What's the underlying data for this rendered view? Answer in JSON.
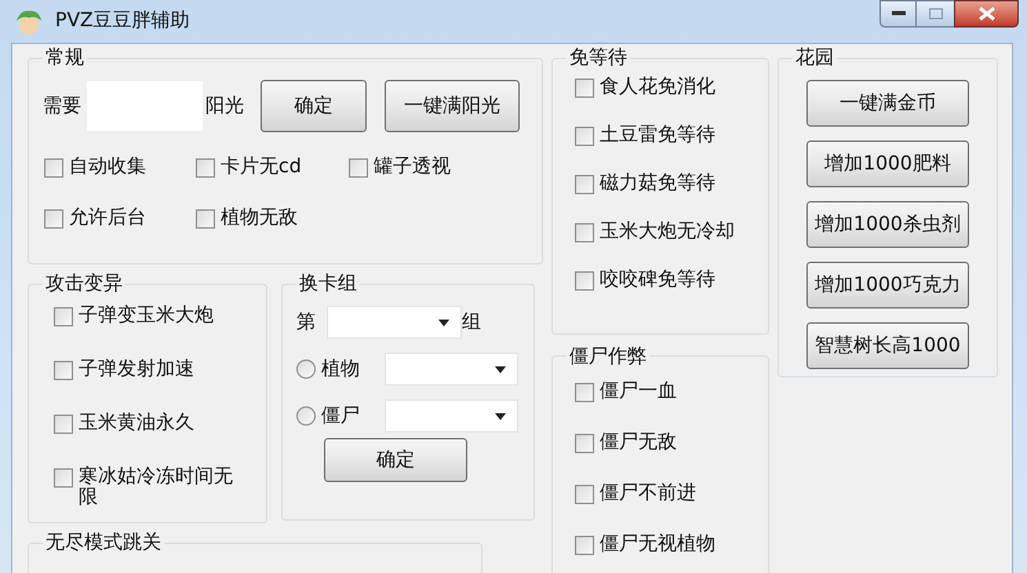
{
  "window": {
    "title": "PVZ豆豆胖辅助"
  },
  "general": {
    "title": "常规",
    "sun_prefix": "需要",
    "sun_suffix": "阳光",
    "buttons": [
      "确定",
      "一键满阳光"
    ],
    "checkboxes": [
      {
        "label": "自动收集",
        "checked": false
      },
      {
        "label": "卡片无cd",
        "checked": false
      },
      {
        "label": "罐子透视",
        "checked": false
      },
      {
        "label": "允许后台",
        "checked": false
      },
      {
        "label": "植物无敌",
        "checked": false
      }
    ]
  },
  "attack_mutation": {
    "title": "攻击变异",
    "checkboxes": [
      {
        "label": "子弹变玉米大炮",
        "checked": false
      },
      {
        "label": "子弹发射加速",
        "checked": false
      },
      {
        "label": "玉米黄油永久",
        "checked": false
      },
      {
        "label": "寒冰姑冷冻时间无限",
        "checked": false
      }
    ]
  },
  "card_group": {
    "title": "换卡组",
    "prefix": "第",
    "suffix": "组",
    "radios": [
      {
        "label": "植物",
        "selected": false
      },
      {
        "label": "僵尸",
        "selected": false
      }
    ],
    "button": "确定"
  },
  "endless": {
    "title": "无尽模式跳关"
  },
  "no_wait": {
    "title": "免等待",
    "checkboxes": [
      {
        "label": "食人花免消化",
        "checked": false
      },
      {
        "label": "土豆雷免等待",
        "checked": false
      },
      {
        "label": "磁力菇免等待",
        "checked": false
      },
      {
        "label": "玉米大炮无冷却",
        "checked": false
      },
      {
        "label": "咬咬碑免等待",
        "checked": false
      }
    ]
  },
  "zombie_cheat": {
    "title": "僵尸作弊",
    "checkboxes": [
      {
        "label": "僵尸一血",
        "checked": false
      },
      {
        "label": "僵尸无敌",
        "checked": false
      },
      {
        "label": "僵尸不前进",
        "checked": false
      },
      {
        "label": "僵尸无视植物",
        "checked": false
      }
    ]
  },
  "garden": {
    "title": "花园",
    "buttons": [
      "一键满金币",
      "增加1000肥料",
      "增加1000杀虫剂",
      "增加1000巧克力",
      "智慧树长高1000"
    ]
  }
}
